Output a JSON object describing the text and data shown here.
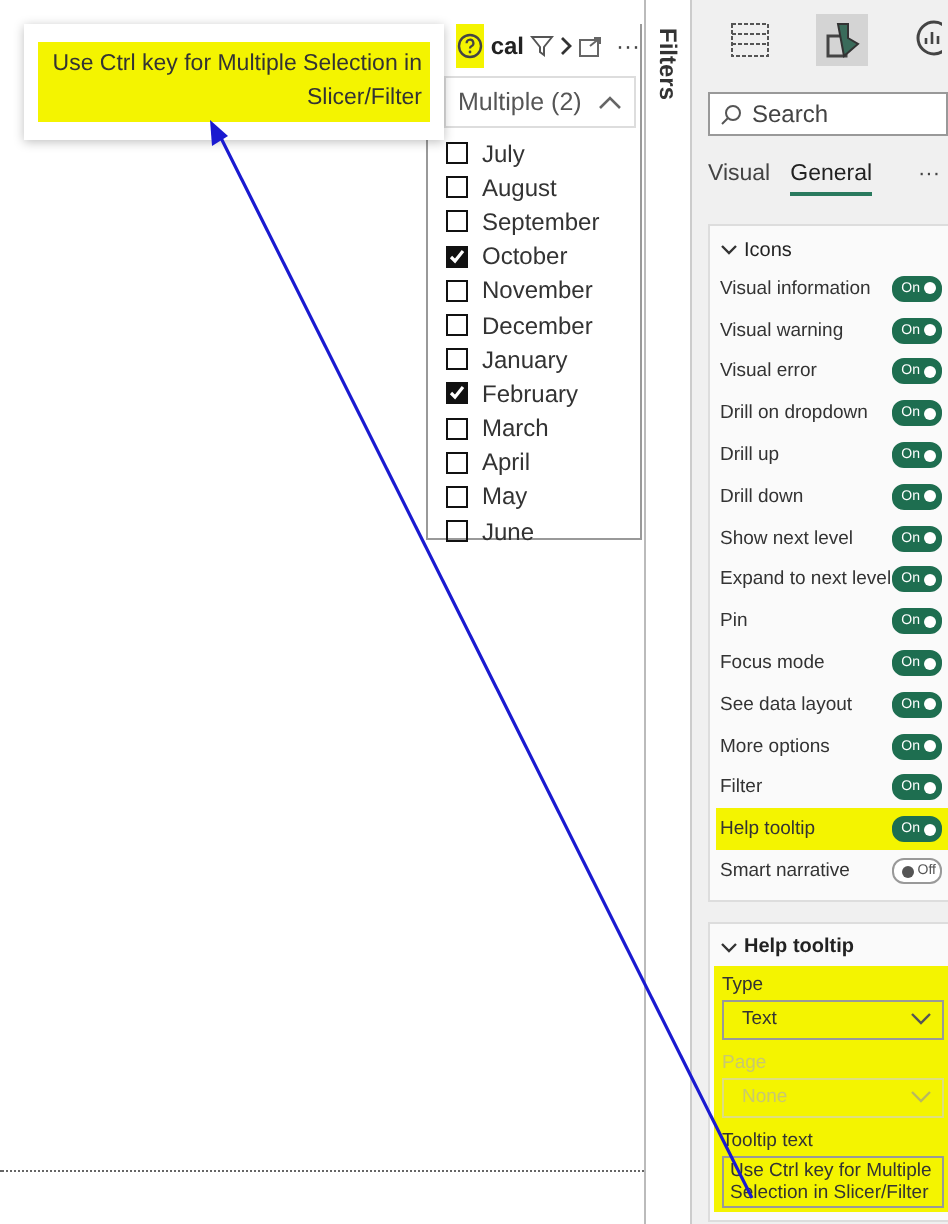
{
  "tooltip_popup": {
    "text": "Use Ctrl key for Multiple Selection in Slicer/Filter",
    "highlighted": true
  },
  "slicer": {
    "title": "cal",
    "help_highlighted": true,
    "more": "···",
    "dropdown": "Multiple (2)",
    "items": [
      {
        "label": "July",
        "checked": false
      },
      {
        "label": "August",
        "checked": false
      },
      {
        "label": "September",
        "checked": false
      },
      {
        "label": "October",
        "checked": true
      },
      {
        "label": "November",
        "checked": false
      },
      {
        "label": "December",
        "checked": false
      },
      {
        "label": "January",
        "checked": false
      },
      {
        "label": "February",
        "checked": true
      },
      {
        "label": "March",
        "checked": false
      },
      {
        "label": "April",
        "checked": false
      },
      {
        "label": "May",
        "checked": false
      },
      {
        "label": "June",
        "checked": false
      }
    ]
  },
  "filters_pane": {
    "label": "Filters"
  },
  "format_pane": {
    "build_tabs": [
      {
        "kind": "fields",
        "selected": false
      },
      {
        "kind": "format",
        "selected": true
      },
      {
        "kind": "analytics",
        "selected": false
      }
    ],
    "search": {
      "placeholder": "Search"
    },
    "tabs": [
      {
        "label": "Visual",
        "selected": false
      },
      {
        "label": "General",
        "selected": true
      }
    ],
    "tabs_more": "···",
    "sections": [
      {
        "kind": "toggles",
        "title": "Icons",
        "expanded": true,
        "rows": [
          {
            "label": "Visual information",
            "on": true,
            "toggle_text": "On",
            "highlighted": false
          },
          {
            "label": "Visual warning",
            "on": true,
            "toggle_text": "On",
            "highlighted": false
          },
          {
            "label": "Visual error",
            "on": true,
            "toggle_text": "On",
            "highlighted": false
          },
          {
            "label": "Drill on dropdown",
            "on": true,
            "toggle_text": "On",
            "highlighted": false
          },
          {
            "label": "Drill up",
            "on": true,
            "toggle_text": "On",
            "highlighted": false
          },
          {
            "label": "Drill down",
            "on": true,
            "toggle_text": "On",
            "highlighted": false
          },
          {
            "label": "Show next level",
            "on": true,
            "toggle_text": "On",
            "highlighted": false
          },
          {
            "label": "Expand to next level",
            "on": true,
            "toggle_text": "On",
            "highlighted": false
          },
          {
            "label": "Pin",
            "on": true,
            "toggle_text": "On",
            "highlighted": false
          },
          {
            "label": "Focus mode",
            "on": true,
            "toggle_text": "On",
            "highlighted": false
          },
          {
            "label": "See data layout",
            "on": true,
            "toggle_text": "On",
            "highlighted": false
          },
          {
            "label": "More options",
            "on": true,
            "toggle_text": "On",
            "highlighted": false
          },
          {
            "label": "Filter",
            "on": true,
            "toggle_text": "On",
            "highlighted": false
          },
          {
            "label": "Help tooltip",
            "on": true,
            "toggle_text": "On",
            "highlighted": true
          },
          {
            "label": "Smart narrative",
            "on": false,
            "toggle_text": "Off",
            "highlighted": false
          }
        ]
      },
      {
        "kind": "fields",
        "title": "Help tooltip",
        "expanded": true,
        "highlighted": true,
        "fields": [
          {
            "kind": "dropdown",
            "label": "Type",
            "value": "Text",
            "disabled": false
          },
          {
            "kind": "dropdown",
            "label": "Page",
            "value": "None",
            "disabled": true
          },
          {
            "kind": "textarea",
            "label": "Tooltip text",
            "value": "Use Ctrl key for Multiple Selection in Slicer/Filter",
            "disabled": false
          }
        ]
      }
    ]
  }
}
